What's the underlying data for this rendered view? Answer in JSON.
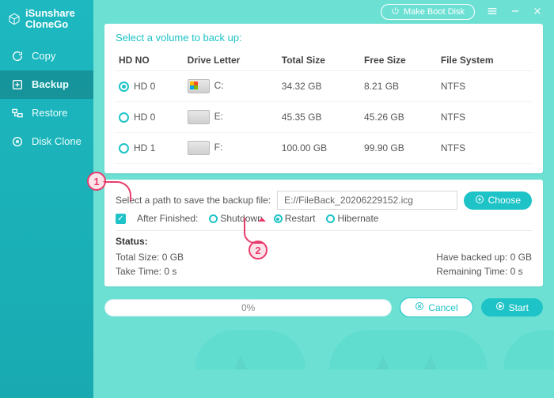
{
  "app": {
    "name": "iSunshare\nCloneGo"
  },
  "titlebar": {
    "make_boot": "Make Boot Disk"
  },
  "nav": {
    "items": [
      {
        "label": "Copy"
      },
      {
        "label": "Backup"
      },
      {
        "label": "Restore"
      },
      {
        "label": "Disk Clone"
      }
    ]
  },
  "volumes": {
    "title": "Select a volume to back up:",
    "headers": {
      "hd": "HD NO",
      "letter": "Drive Letter",
      "total": "Total Size",
      "free": "Free Size",
      "fs": "File System"
    },
    "rows": [
      {
        "hd": "HD 0",
        "letter": "C:",
        "total": "34.32 GB",
        "free": "8.21 GB",
        "fs": "NTFS",
        "selected": true,
        "os": true
      },
      {
        "hd": "HD 0",
        "letter": "E:",
        "total": "45.35 GB",
        "free": "45.26 GB",
        "fs": "NTFS",
        "selected": false,
        "os": false
      },
      {
        "hd": "HD 1",
        "letter": "F:",
        "total": "100.00 GB",
        "free": "99.90 GB",
        "fs": "NTFS",
        "selected": false,
        "os": false
      }
    ]
  },
  "backup": {
    "path_label": "Select a path to save the backup file:",
    "path_value": "E://FileBack_20206229152.icg",
    "choose": "Choose",
    "after_label": "After Finished:",
    "options": {
      "shutdown": "Shutdown",
      "restart": "Restart",
      "hibernate": "Hibernate"
    },
    "status_label": "Status:",
    "total_size": "Total Size: 0 GB",
    "take_time": "Take Time: 0 s",
    "backed_up": "Have backed up: 0 GB",
    "remaining": "Remaining Time: 0 s"
  },
  "footer": {
    "progress": "0%",
    "cancel": "Cancel",
    "start": "Start"
  },
  "callouts": {
    "one": "1",
    "two": "2"
  }
}
